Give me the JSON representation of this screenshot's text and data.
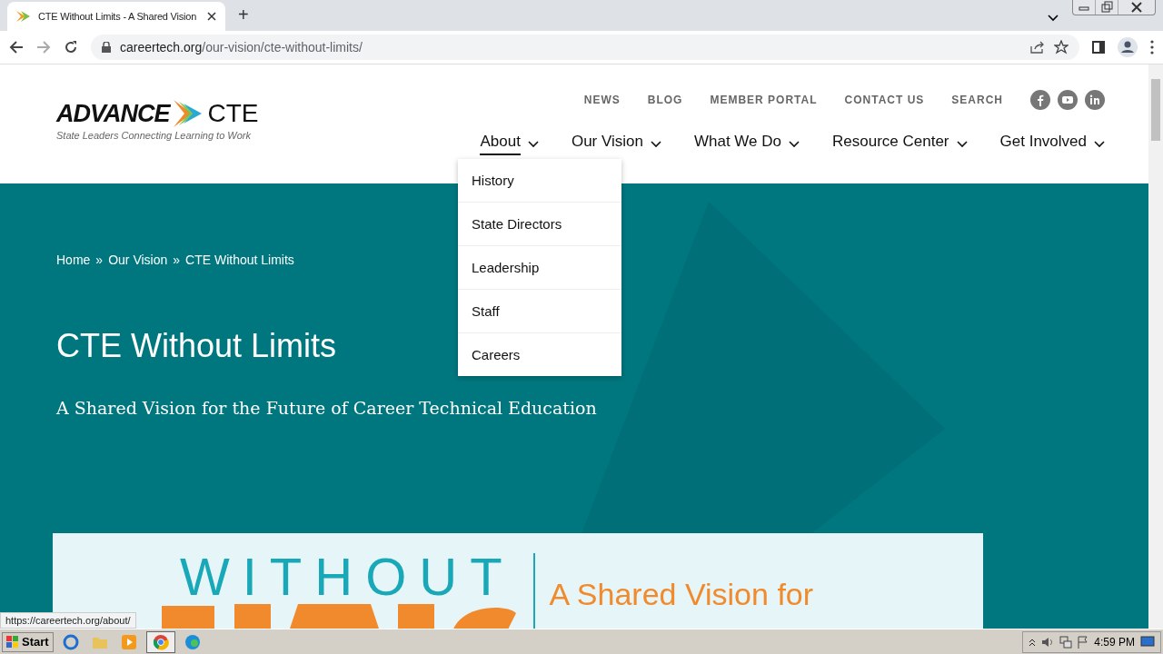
{
  "browser": {
    "tab": {
      "title": "CTE Without Limits - A Shared Vision",
      "new_tab": "+"
    },
    "address": {
      "domain": "careertech.org",
      "path": "/our-vision/cte-without-limits/"
    }
  },
  "site": {
    "logo": {
      "wordmark": "ADVANCE",
      "suffix": "CTE",
      "tagline": "State Leaders Connecting Learning to Work"
    },
    "utility_nav": [
      "NEWS",
      "BLOG",
      "MEMBER PORTAL",
      "CONTACT US",
      "SEARCH"
    ],
    "main_nav": [
      {
        "label": "About",
        "selected": true
      },
      {
        "label": "Our Vision",
        "selected": false
      },
      {
        "label": "What We Do",
        "selected": false
      },
      {
        "label": "Resource Center",
        "selected": false
      },
      {
        "label": "Get Involved",
        "selected": false
      }
    ],
    "dropdown": [
      "History",
      "State Directors",
      "Leadership",
      "Staff",
      "Careers"
    ]
  },
  "hero": {
    "breadcrumb": [
      "Home",
      "Our Vision",
      "CTE Without Limits"
    ],
    "separators": [
      "»",
      "»"
    ],
    "title": "CTE Without Limits",
    "subtitle": "A Shared Vision for the Future of Career Technical Education"
  },
  "banner": {
    "heading": "WITHOUT",
    "tagline": "A Shared Vision for"
  },
  "status_url": "https://careertech.org/about/",
  "taskbar": {
    "start": "Start",
    "clock": "4:59 PM"
  }
}
